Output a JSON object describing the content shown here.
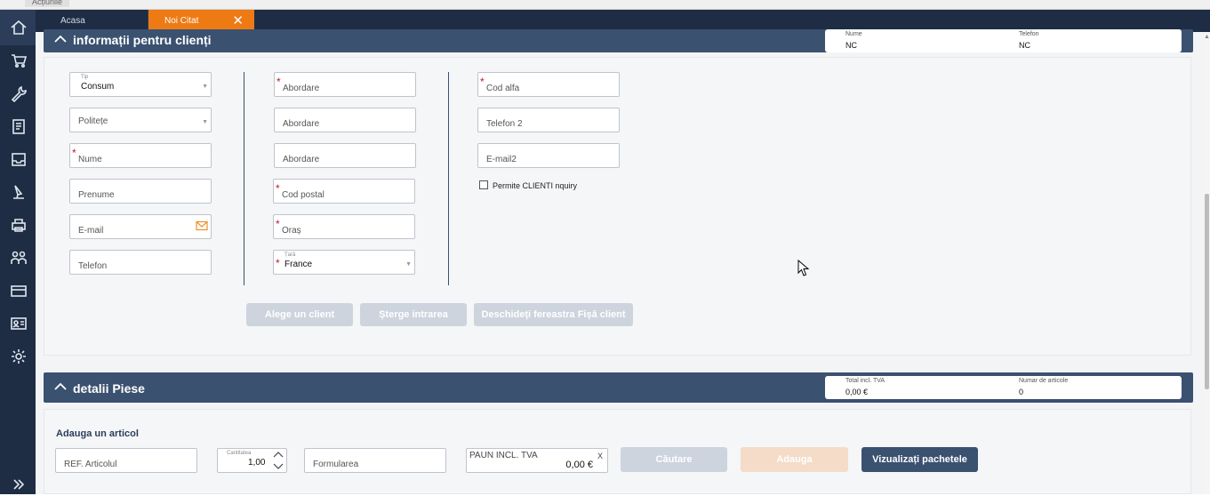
{
  "top_strip": {
    "label": "Acțiunile"
  },
  "tabs": [
    {
      "label": "Acasa"
    },
    {
      "label": "Noi Citat",
      "close": "✕"
    }
  ],
  "sidebar": {
    "items": [
      "home-icon",
      "cart-icon",
      "wrench-icon",
      "document-icon",
      "inbox-icon",
      "pen-tool-icon",
      "printer-icon",
      "people-icon",
      "card-icon",
      "contact-card-icon",
      "gear-icon",
      "expand-icon"
    ]
  },
  "client_panel": {
    "title": "informații pentru clienți",
    "summary": [
      {
        "label": "Nume",
        "value": "NC"
      },
      {
        "label": "Telefon",
        "value": "NC"
      }
    ],
    "col1": {
      "tip_label": "Tip",
      "tip_value": "Consum",
      "politete": "Politețe",
      "nume": "Nume",
      "prenume": "Prenume",
      "email": "E-mail",
      "telefon": "Telefon"
    },
    "col2": {
      "abordare1": "Abordare",
      "abordare2": "Abordare",
      "abordare3": "Abordare",
      "cod_postal": "Cod postal",
      "oras": "Oraș",
      "tara_label": "Țară",
      "tara_value": "France"
    },
    "col3": {
      "cod_alfa": "Cod alfa",
      "telefon2": "Telefon 2",
      "email2": "E-mail2",
      "permite": "Permite CLIENTI nquiry"
    },
    "buttons": {
      "alege": "Alege un client",
      "sterge": "Șterge intrarea",
      "deschide": "Deschideți fereastra Fișă client"
    }
  },
  "parts_panel": {
    "title": "detalii Piese",
    "summary": [
      {
        "label": "Total incl. TVA",
        "value": "0,00 €"
      },
      {
        "label": "Numar de articole",
        "value": "0"
      }
    ],
    "add_title": "Adauga un articol",
    "ref": "REF. Articolul",
    "cantitate_label": "Cantitatea",
    "cantitate_value": "1,00",
    "formularea": "Formularea",
    "pret_label": "PAUN INCL. TVA",
    "pret_value": "0,00 €",
    "pret_clear": "X",
    "buttons": {
      "cautare": "Căutare",
      "adauga": "Adauga",
      "pachete": "Vizualizați pachetele"
    }
  },
  "colors": {
    "accent": "#ee7a14",
    "navy": "#1e2d44",
    "panel": "#3b5170",
    "required": "#c0182f"
  }
}
